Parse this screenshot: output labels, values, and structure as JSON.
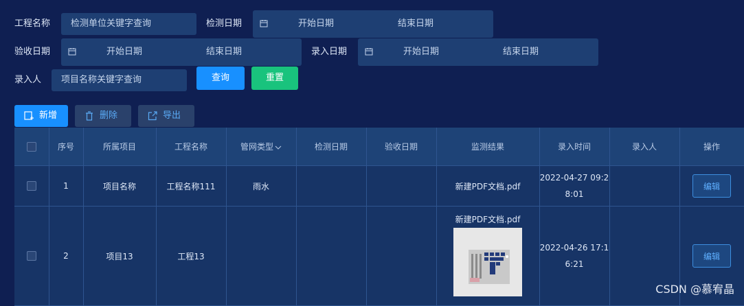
{
  "filters": {
    "project_name": {
      "label": "工程名称",
      "placeholder": "检测单位关键字查询"
    },
    "test_date": {
      "label": "检测日期",
      "start": "开始日期",
      "end": "结束日期"
    },
    "acceptance_date": {
      "label": "验收日期",
      "start": "开始日期",
      "end": "结束日期"
    },
    "entry_date": {
      "label": "录入日期",
      "start": "开始日期",
      "end": "结束日期"
    },
    "entry_person": {
      "label": "录入人",
      "placeholder": "项目名称关键字查询"
    },
    "query_label": "查询",
    "reset_label": "重置"
  },
  "toolbar": {
    "add": "新增",
    "delete": "删除",
    "export": "导出"
  },
  "table": {
    "columns": [
      "序号",
      "所属项目",
      "工程名称",
      "管网类型",
      "检测日期",
      "验收日期",
      "监测结果",
      "录入时间",
      "录入人",
      "操作"
    ],
    "rows": [
      {
        "index": "1",
        "project": "项目名称",
        "engineering": "工程名称111",
        "network_type": "雨水",
        "test_date": "",
        "acceptance_date": "",
        "result": "新建PDF文档.pdf",
        "entry_time_a": "2022-04-27 09:2",
        "entry_time_b": "8:01",
        "person": "",
        "action": "编辑"
      },
      {
        "index": "2",
        "project": "项目13",
        "engineering": "工程13",
        "network_type": "",
        "test_date": "",
        "acceptance_date": "",
        "result": "新建PDF文档.pdf",
        "entry_time_a": "2022-04-26 17:1",
        "entry_time_b": "6:21",
        "person": "",
        "action": "编辑"
      }
    ]
  },
  "watermark": "CSDN @慕宥晶",
  "colors": {
    "primary": "#1890ff",
    "success": "#19c37d",
    "background": "#0f1f52"
  }
}
